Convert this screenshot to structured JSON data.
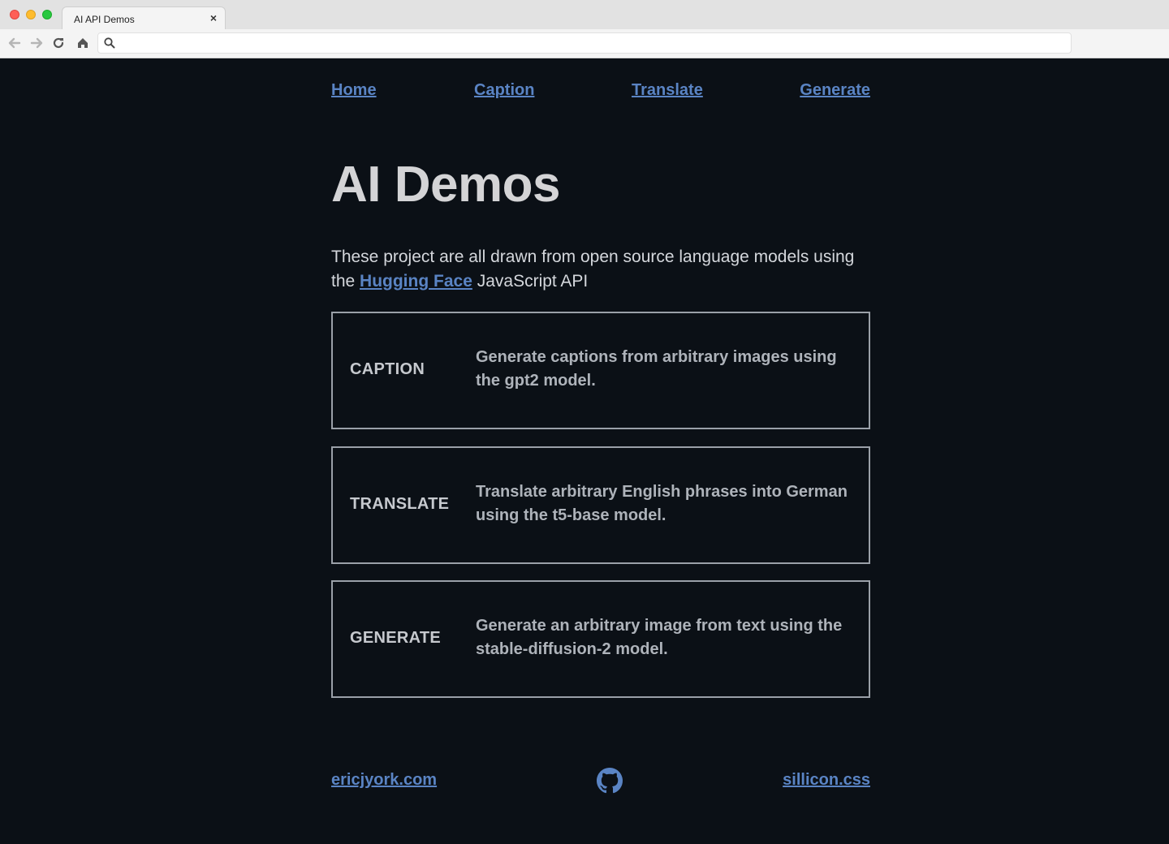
{
  "browser": {
    "tab_title": "AI API Demos",
    "tab_close": "×",
    "url": ""
  },
  "nav": {
    "home": "Home",
    "caption": "Caption",
    "translate": "Translate",
    "generate": "Generate"
  },
  "hero": {
    "title": "AI Demos",
    "intro_before": "These project are all drawn from open source language models using the ",
    "intro_link": "Hugging Face",
    "intro_after": " JavaScript API"
  },
  "cards": [
    {
      "label": "CAPTION",
      "description": "Generate captions from arbitrary images using the gpt2 model."
    },
    {
      "label": "TRANSLATE",
      "description": "Translate arbitrary English phrases into German using the t5-base model."
    },
    {
      "label": "GENERATE",
      "description": "Generate an arbitrary image from text using the stable-diffusion-2 model."
    }
  ],
  "footer": {
    "left_link": "ericjyork.com",
    "center_icon": "github-icon",
    "right_link": "sillicon.css"
  },
  "colors": {
    "background": "#0b1016",
    "link": "#5a84c4",
    "card_border": "#9aa0a8"
  }
}
